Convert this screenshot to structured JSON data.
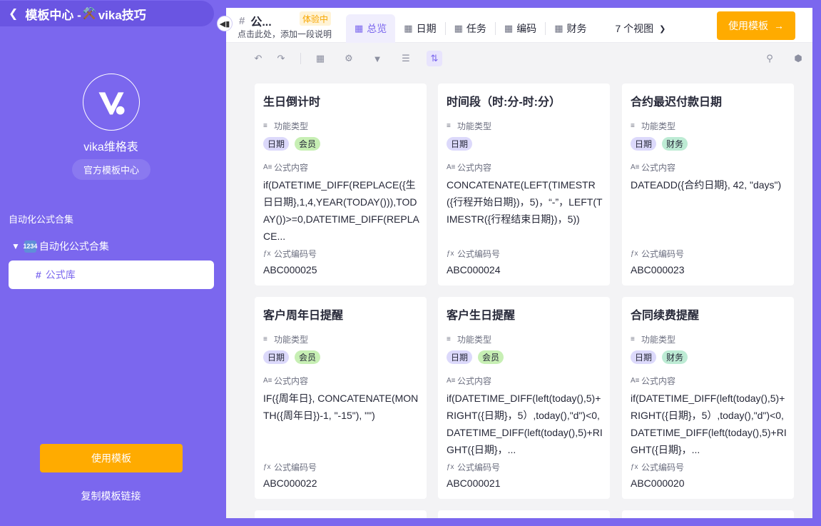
{
  "sidebar": {
    "header_title": "模板中心 - ",
    "header_brand": "vika技巧",
    "name": "vika维格表",
    "badge": "官方模板中心",
    "section_label": "自动化公式合集",
    "folder_label": "自动化公式合集",
    "item_label": "公式库",
    "use_button": "使用模板",
    "copy_link": "复制模板链接"
  },
  "header": {
    "datasheet_name": "公...",
    "trial_badge": "体验中",
    "description": "点击此处，添加一段说明",
    "tabs": [
      {
        "label": "总览",
        "active": true
      },
      {
        "label": "日期",
        "active": false
      },
      {
        "label": "任务",
        "active": false
      },
      {
        "label": "编码",
        "active": false
      },
      {
        "label": "财务",
        "active": false
      }
    ],
    "views_dropdown": "7 个视图",
    "use_button": "使用模板"
  },
  "field_labels": {
    "type": "功能类型",
    "content": "公式内容",
    "code": "公式编码号"
  },
  "cards": [
    {
      "title": "生日倒计时",
      "tags": [
        "日期",
        "会员"
      ],
      "tag_kinds": [
        "date",
        "member"
      ],
      "formula": "if(DATETIME_DIFF(REPLACE({生日日期},1,4,YEAR(TODAY())),TODAY())>=0,DATETIME_DIFF(REPLACE...",
      "code": "ABC000025"
    },
    {
      "title": "时间段（时:分-时:分）",
      "tags": [
        "日期"
      ],
      "tag_kinds": [
        "date"
      ],
      "formula": "CONCATENATE(LEFT(TIMESTR({行程开始日期})，5)，“-”，LEFT(TIMESTR({行程结束日期})，5))",
      "code": "ABC000024"
    },
    {
      "title": "合约最迟付款日期",
      "tags": [
        "日期",
        "财务"
      ],
      "tag_kinds": [
        "date",
        "finance"
      ],
      "formula": "DATEADD({合约日期}, 42, \"days\")",
      "code": "ABC000023"
    },
    {
      "title": "客户周年日提醒",
      "tags": [
        "日期",
        "会员"
      ],
      "tag_kinds": [
        "date",
        "member"
      ],
      "formula": "IF({周年日}, CONCATENATE(MONTH({周年日})-1, \"-15\"), \"\")",
      "code": "ABC000022"
    },
    {
      "title": "客户生日提醒",
      "tags": [
        "日期",
        "会员"
      ],
      "tag_kinds": [
        "date",
        "member"
      ],
      "formula": "if(DATETIME_DIFF(left(today(),5)+RIGHT({日期}，5）,today(),\"d\")<0,DATETIME_DIFF(left(today(),5)+RIGHT({日期}，...",
      "code": "ABC000021"
    },
    {
      "title": "合同续费提醒",
      "tags": [
        "日期",
        "财务"
      ],
      "tag_kinds": [
        "date",
        "finance"
      ],
      "formula": "if(DATETIME_DIFF(left(today(),5)+RIGHT({日期}，5）,today(),\"d\")<0,DATETIME_DIFF(left(today(),5)+RIGHT({日期}，...",
      "code": "ABC000020"
    }
  ],
  "colors": {
    "brand": "#7b67ee",
    "accent": "#ffab00"
  }
}
